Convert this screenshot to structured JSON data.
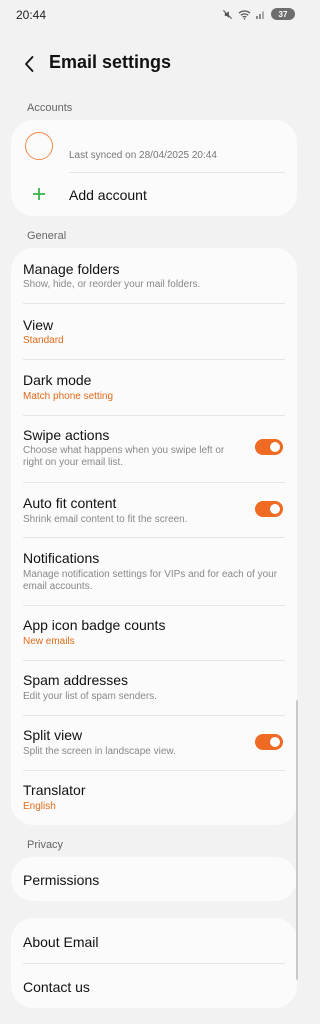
{
  "status": {
    "time": "20:44",
    "battery": "37"
  },
  "header": {
    "title": "Email settings"
  },
  "accounts": {
    "label": "Accounts",
    "last_synced": "Last synced on 28/04/2025  20:44",
    "add_account": "Add account"
  },
  "general": {
    "label": "General",
    "items": [
      {
        "title": "Manage folders",
        "subtitle": "Show, hide, or reorder your mail folders."
      },
      {
        "title": "View",
        "value": "Standard"
      },
      {
        "title": "Dark mode",
        "value": "Match phone setting"
      },
      {
        "title": "Swipe actions",
        "subtitle": "Choose what happens when you swipe left or right on your email list.",
        "toggle": true
      },
      {
        "title": "Auto fit content",
        "subtitle": "Shrink email content to fit the screen.",
        "toggle": true
      },
      {
        "title": "Notifications",
        "subtitle": "Manage notification settings for VIPs and for each of your email accounts."
      },
      {
        "title": "App icon badge counts",
        "value": "New emails"
      },
      {
        "title": "Spam addresses",
        "subtitle": "Edit your list of spam senders."
      },
      {
        "title": "Split view",
        "subtitle": "Split the screen in landscape view.",
        "toggle": true
      },
      {
        "title": "Translator",
        "value": "English"
      }
    ]
  },
  "privacy": {
    "label": "Privacy",
    "permissions": "Permissions"
  },
  "about": {
    "about_email": "About Email",
    "contact_us": "Contact us"
  },
  "colors": {
    "accent": "#ef6a22",
    "add_icon": "#3bb54a",
    "background": "#f2f2f2",
    "card": "#fbfbfb"
  }
}
